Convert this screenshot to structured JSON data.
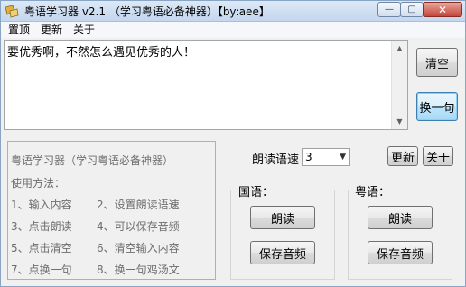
{
  "window": {
    "title": "粤语学习器  v2.1  （学习粤语必备神器）【by:aee】",
    "min_symbol": "—",
    "max_symbol": "▢",
    "close_symbol": "✕"
  },
  "menu": {
    "items": [
      "置顶",
      "更新",
      "关于"
    ]
  },
  "input": {
    "value": "要优秀啊，不然怎么遇见优秀的人！"
  },
  "side_buttons": {
    "clear": "清空",
    "next_sentence": "换一句"
  },
  "help_panel": {
    "title": "粤语学习器（学习粤语必备神器）",
    "subtitle": "使用方法：",
    "steps": [
      "1、输入内容",
      "2、设置朗读语速",
      "3、点击朗读",
      "4、可以保存音频",
      "5、点击清空",
      "6、清空输入内容",
      "7、点换一句",
      "8、换一句鸡汤文"
    ]
  },
  "speed": {
    "label": "朗读语速",
    "selected": "3"
  },
  "top_buttons": {
    "update": "更新",
    "about": "关于"
  },
  "mandarin": {
    "title": "国语：",
    "read": "朗读",
    "save": "保存音频"
  },
  "cantonese": {
    "title": "粤语：",
    "read": "朗读",
    "save": "保存音频"
  },
  "colors": {
    "title_gradient_top": "#dce8f6",
    "close_red": "#c4473a",
    "focus_blue": "#3c7fb1",
    "panel_text_gray": "#6d6d6d"
  }
}
